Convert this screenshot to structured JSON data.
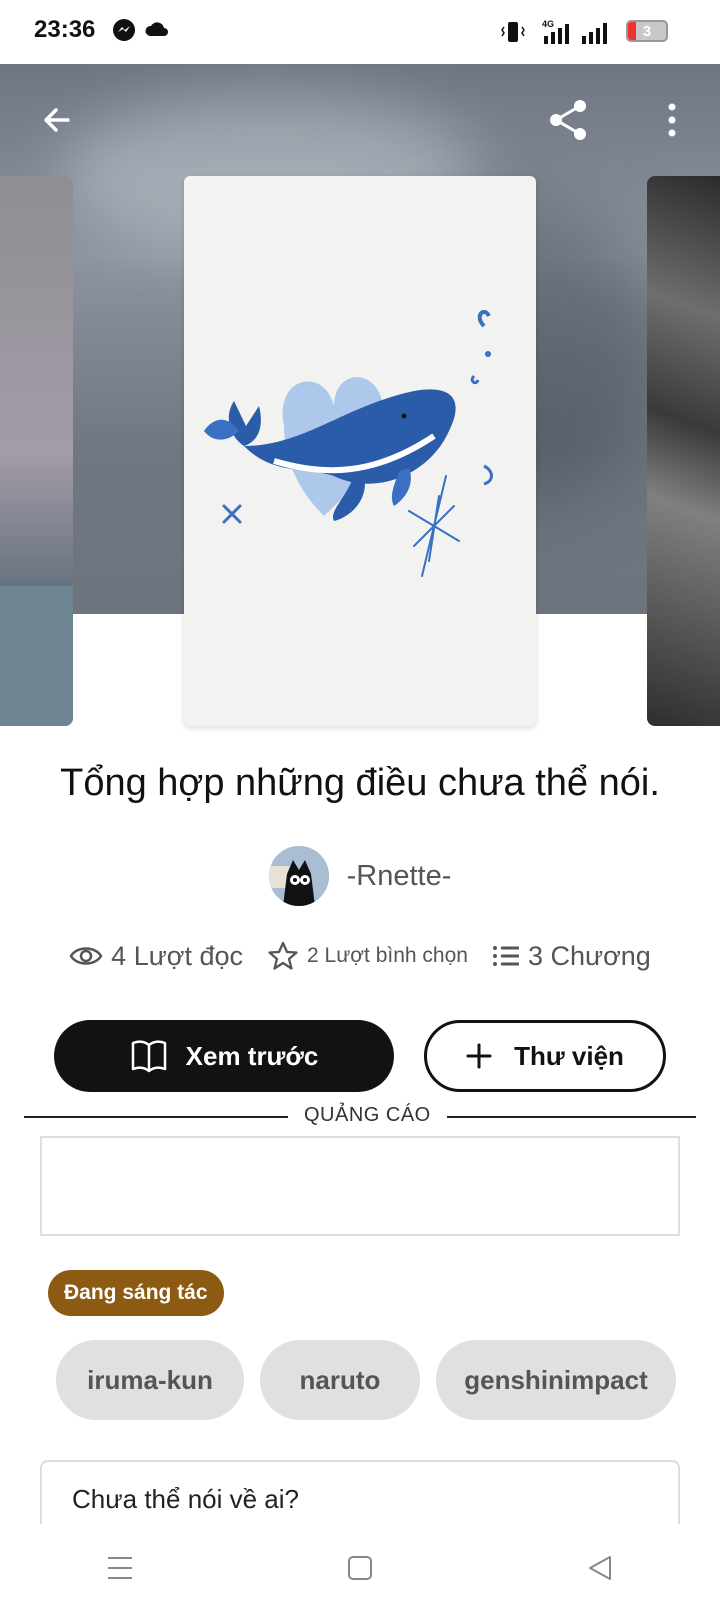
{
  "status_bar": {
    "time": "23:36",
    "battery_level": "3"
  },
  "book": {
    "title": "Tổng hợp những điều chưa thể nói.",
    "author": "-Rnette-",
    "stats": {
      "reads": "4 Lượt đọc",
      "votes": "2 Lượt bình chọn",
      "chapters": "3 Chương"
    },
    "status": "Đang sáng tác",
    "tags": [
      "iruma-kun",
      "naruto",
      "genshinimpact"
    ],
    "description": "Chưa thể nói về ai?"
  },
  "actions": {
    "preview_label": "Xem trước",
    "library_label": "Thư viện"
  },
  "ad": {
    "label": "QUẢNG CÁO"
  },
  "colors": {
    "status_badge": "#8c5a12",
    "primary_button": "#121212",
    "tag_bg": "#e0e0e0",
    "whale_blue": "#2a5caa"
  },
  "icons": [
    "back-arrow-icon",
    "share-icon",
    "more-vert-icon",
    "eye-icon",
    "star-icon",
    "list-icon",
    "book-open-icon",
    "plus-icon",
    "menu-nav-icon",
    "home-nav-icon",
    "back-nav-icon"
  ]
}
